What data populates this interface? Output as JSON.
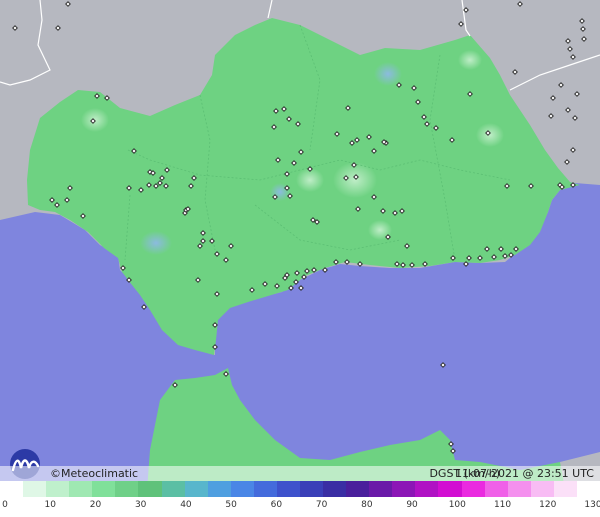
{
  "footer": {
    "brand": "©Meteoclimatic",
    "field": "DGST (km/h)",
    "timestamp": "11-07-2021 @ 23:51 UTC"
  },
  "scale": {
    "unit": "km/h",
    "ticks": [
      "0",
      "10",
      "20",
      "30",
      "40",
      "50",
      "60",
      "70",
      "80",
      "90",
      "100",
      "110",
      "120",
      "130"
    ],
    "colors": [
      "#ffffff",
      "#dff7e6",
      "#bff0cc",
      "#9fe8b2",
      "#80e09a",
      "#6fd088",
      "#5fc27a",
      "#5bbfa4",
      "#58b6cc",
      "#4f9fe0",
      "#4a86e6",
      "#446bdc",
      "#3e52cc",
      "#3a3fb8",
      "#3a2ea4",
      "#4a1f9c",
      "#6a1aa8",
      "#8c16b6",
      "#b012c4",
      "#d20ed2",
      "#ea2ae0",
      "#f060e8",
      "#f490ee",
      "#f8bcf4",
      "#fbe0f8",
      "#ffffff"
    ]
  },
  "colors": {
    "sea": "#7f85de",
    "land": "#6ed282",
    "mountain": "#b6b8c0",
    "station": "#222222"
  },
  "stations": [
    [
      15,
      28
    ],
    [
      58,
      28
    ],
    [
      68,
      4
    ],
    [
      97,
      96
    ],
    [
      107,
      98
    ],
    [
      93,
      121
    ],
    [
      134,
      151
    ],
    [
      150,
      172
    ],
    [
      149,
      185
    ],
    [
      156,
      186
    ],
    [
      160,
      183
    ],
    [
      162,
      178
    ],
    [
      166,
      186
    ],
    [
      167,
      170
    ],
    [
      153,
      173
    ],
    [
      141,
      190
    ],
    [
      129,
      188
    ],
    [
      70,
      188
    ],
    [
      67,
      200
    ],
    [
      52,
      200
    ],
    [
      57,
      205
    ],
    [
      83,
      216
    ],
    [
      185,
      213
    ],
    [
      186,
      210
    ],
    [
      188,
      209
    ],
    [
      203,
      233
    ],
    [
      212,
      241
    ],
    [
      203,
      241
    ],
    [
      200,
      246
    ],
    [
      217,
      254
    ],
    [
      231,
      246
    ],
    [
      226,
      260
    ],
    [
      198,
      280
    ],
    [
      217,
      294
    ],
    [
      129,
      280
    ],
    [
      123,
      268
    ],
    [
      144,
      307
    ],
    [
      215,
      347
    ],
    [
      215,
      325
    ],
    [
      175,
      385
    ],
    [
      226,
      374
    ],
    [
      194,
      178
    ],
    [
      191,
      186
    ],
    [
      274,
      127
    ],
    [
      276,
      111
    ],
    [
      284,
      109
    ],
    [
      298,
      124
    ],
    [
      289,
      119
    ],
    [
      278,
      160
    ],
    [
      275,
      197
    ],
    [
      287,
      174
    ],
    [
      287,
      188
    ],
    [
      294,
      163
    ],
    [
      301,
      152
    ],
    [
      310,
      169
    ],
    [
      313,
      220
    ],
    [
      317,
      222
    ],
    [
      337,
      134
    ],
    [
      348,
      108
    ],
    [
      352,
      143
    ],
    [
      357,
      140
    ],
    [
      369,
      137
    ],
    [
      374,
      151
    ],
    [
      386,
      143
    ],
    [
      399,
      85
    ],
    [
      414,
      88
    ],
    [
      424,
      117
    ],
    [
      418,
      102
    ],
    [
      427,
      124
    ],
    [
      436,
      128
    ],
    [
      452,
      140
    ],
    [
      470,
      94
    ],
    [
      488,
      133
    ],
    [
      507,
      186
    ],
    [
      531,
      186
    ],
    [
      560,
      185
    ],
    [
      562,
      187
    ],
    [
      573,
      185
    ],
    [
      356,
      177
    ],
    [
      374,
      197
    ],
    [
      358,
      209
    ],
    [
      383,
      211
    ],
    [
      395,
      213
    ],
    [
      402,
      211
    ],
    [
      388,
      237
    ],
    [
      407,
      246
    ],
    [
      425,
      264
    ],
    [
      412,
      265
    ],
    [
      403,
      265
    ],
    [
      397,
      264
    ],
    [
      360,
      264
    ],
    [
      347,
      262
    ],
    [
      336,
      262
    ],
    [
      325,
      270
    ],
    [
      314,
      270
    ],
    [
      304,
      277
    ],
    [
      307,
      271
    ],
    [
      297,
      273
    ],
    [
      287,
      275
    ],
    [
      291,
      288
    ],
    [
      301,
      288
    ],
    [
      296,
      282
    ],
    [
      285,
      278
    ],
    [
      277,
      286
    ],
    [
      265,
      284
    ],
    [
      252,
      290
    ],
    [
      466,
      264
    ],
    [
      487,
      249
    ],
    [
      494,
      257
    ],
    [
      501,
      249
    ],
    [
      505,
      256
    ],
    [
      511,
      255
    ],
    [
      516,
      249
    ],
    [
      480,
      258
    ],
    [
      469,
      258
    ],
    [
      453,
      258
    ],
    [
      384,
      142
    ],
    [
      568,
      41
    ],
    [
      570,
      49
    ],
    [
      573,
      57
    ],
    [
      582,
      21
    ],
    [
      583,
      29
    ],
    [
      584,
      39
    ],
    [
      577,
      94
    ],
    [
      561,
      85
    ],
    [
      553,
      98
    ],
    [
      551,
      116
    ],
    [
      568,
      110
    ],
    [
      575,
      118
    ],
    [
      573,
      150
    ],
    [
      567,
      162
    ],
    [
      515,
      72
    ],
    [
      520,
      4
    ],
    [
      461,
      24
    ],
    [
      466,
      10
    ],
    [
      451,
      444
    ],
    [
      453,
      451
    ],
    [
      443,
      365
    ],
    [
      346,
      178
    ],
    [
      354,
      165
    ],
    [
      290,
      196
    ]
  ]
}
